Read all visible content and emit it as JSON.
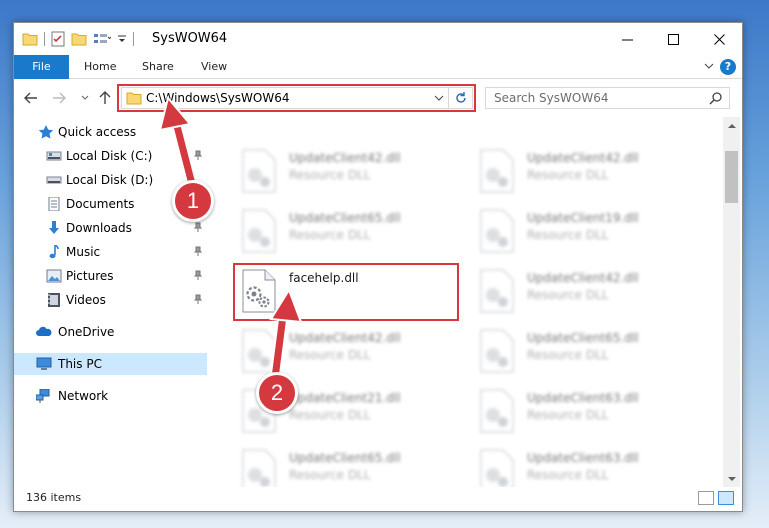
{
  "window": {
    "title": "SysWOW64"
  },
  "ribbon": {
    "tabs": [
      "File",
      "Home",
      "Share",
      "View"
    ],
    "help_label": "?"
  },
  "address": {
    "path": "C:\\Windows\\SysWOW64",
    "search_placeholder": "Search SysWOW64"
  },
  "sidebar": {
    "items": [
      {
        "label": "Quick access",
        "icon": "star-icon",
        "pinned": false
      },
      {
        "label": "Local Disk (C:)",
        "icon": "drive-icon",
        "pinned": true
      },
      {
        "label": "Local Disk (D:)",
        "icon": "drive-icon",
        "pinned": true
      },
      {
        "label": "Documents",
        "icon": "document-icon",
        "pinned": true
      },
      {
        "label": "Downloads",
        "icon": "download-icon",
        "pinned": true
      },
      {
        "label": "Music",
        "icon": "music-icon",
        "pinned": true
      },
      {
        "label": "Pictures",
        "icon": "pictures-icon",
        "pinned": true
      },
      {
        "label": "Videos",
        "icon": "videos-icon",
        "pinned": true
      },
      {
        "label": "OneDrive",
        "icon": "cloud-icon",
        "pinned": false
      },
      {
        "label": "This PC",
        "icon": "computer-icon",
        "pinned": false,
        "selected": true
      },
      {
        "label": "Network",
        "icon": "network-icon",
        "pinned": false
      }
    ]
  },
  "files": {
    "left": [
      {
        "name": "UpdateClient42.dll",
        "type": "Resource DLL"
      },
      {
        "name": "UpdateClient65.dll",
        "type": "Resource DLL"
      },
      {
        "name": "facehelp.dll",
        "type": ""
      },
      {
        "name": "UpdateClient42.dll",
        "type": "Resource DLL"
      },
      {
        "name": "UpdateClient21.dll",
        "type": "Resource DLL"
      },
      {
        "name": "UpdateClient65.dll",
        "type": "Resource DLL"
      }
    ],
    "right": [
      {
        "name": "UpdateClient42.dll",
        "type": "Resource DLL"
      },
      {
        "name": "UpdateClient19.dll",
        "type": "Resource DLL"
      },
      {
        "name": "UpdateClient42.dll",
        "type": "Resource DLL"
      },
      {
        "name": "UpdateClient65.dll",
        "type": "Resource DLL"
      },
      {
        "name": "UpdateClient63.dll",
        "type": "Resource DLL"
      },
      {
        "name": "UpdateClient63.dll",
        "type": "Resource DLL"
      }
    ]
  },
  "status": {
    "item_count": "136 items"
  },
  "annotations": {
    "step1": "1",
    "step2": "2",
    "color": "#d3393f"
  },
  "colors": {
    "accent": "#1979ca",
    "selection": "#cce8ff",
    "highlight": "#d9363e"
  }
}
